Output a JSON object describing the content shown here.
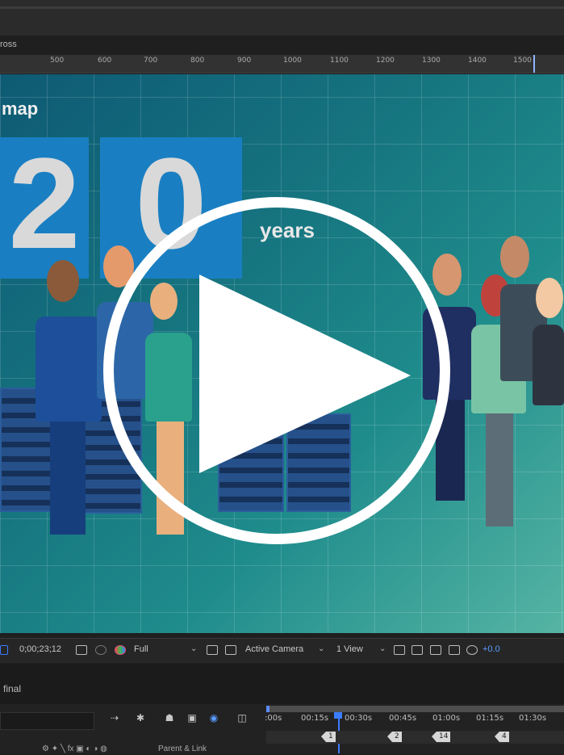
{
  "app": {
    "composition_tab": "ross",
    "panel_title": "final"
  },
  "ruler": {
    "ticks": [
      "500",
      "600",
      "700",
      "800",
      "900",
      "1000",
      "1100",
      "1200",
      "1300",
      "1400",
      "1500"
    ]
  },
  "viewer": {
    "title": "map",
    "tiles": [
      "2",
      "0"
    ],
    "years_label": "years",
    "play_button": "play-icon"
  },
  "toolbar": {
    "timecode": "0;00;23;12",
    "resolution": "Full",
    "camera": "Active Camera",
    "views": "1 View",
    "exposure": "+0.0"
  },
  "timeline": {
    "time_labels": [
      ":00s",
      "00:15s",
      "00:30s",
      "00:45s",
      "01:00s",
      "01:15s",
      "01:30s"
    ],
    "markers": [
      "1",
      "2",
      "14",
      "4"
    ],
    "parent_link_label": "Parent & Link"
  },
  "colors": {
    "accent": "#3b7cff",
    "viewer_bg_start": "#0e5a74",
    "viewer_bg_end": "#56b5a4",
    "tile_blue": "#1a7fc2"
  }
}
